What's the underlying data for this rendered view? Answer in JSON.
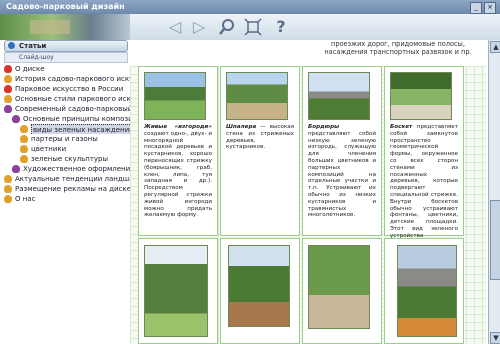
{
  "window": {
    "title": "Садово-парковый дизайн"
  },
  "toolbar": {
    "buttons": [
      "back-icon",
      "forward-icon",
      "search-icon",
      "fullscreen-icon",
      "help-icon"
    ]
  },
  "sidebar": {
    "tab": "Статьи",
    "subtab": "Слайд-шоу",
    "items": [
      {
        "label": "О диске"
      },
      {
        "label": "История садово-паркового искусства"
      },
      {
        "label": "Парковое искусство в России"
      },
      {
        "label": "Основные стили паркового искусства"
      },
      {
        "label": "Современный садово-парковый дизайн"
      },
      {
        "label": "Основные принципы композиции"
      },
      {
        "label": "виды зеленых насаждений"
      },
      {
        "label": "партеры и газоны"
      },
      {
        "label": "цветники"
      },
      {
        "label": "зеленые скульптуры"
      },
      {
        "label": "Художественное оформление территорий"
      },
      {
        "label": "Актуальные тенденции ландшафтного дизайна"
      },
      {
        "label": "Размещение рекламы на диске"
      },
      {
        "label": "О нас"
      }
    ]
  },
  "content": {
    "intro": "проезжих дорог, придомовые полосы, насаждения транспортных развязок и пр.",
    "captions": [
      {
        "term": "Живые «изгороди»",
        "text": "создают одно-, двух- и многорядной посадкой деревьев и кустарников, хорошо переносящих стрижку (боярышник, граб, клен, липа, туя западная и др.). Посредством регулярной стрижки живой изгороди можно придать желаемую форму."
      },
      {
        "term": "Шпалера",
        "text": "— высокая стена из стриженых деревьев, кустарников."
      },
      {
        "term": "Бордюры",
        "text": "представляют собой низкую зеленую изгородь, служащую для членения больших цветников и партерных композиций на отдельные участки и т.п. Устраивают их обычно из низких кустарников и травянистых многолетников."
      },
      {
        "term": "Боскет",
        "text": "представляет собой замкнутое пространство геометрической формы, окруженное со всех сторон стенами из посаженных деревьев, которые подвергают специальной стрижке. Внутри боскетов обычно устраивают фонтаны, цветники, детские площадки. Этот вид зеленого устройства составляет основу композиции растений при регулярных приемах парковой планировки."
      }
    ]
  },
  "colors": {
    "titlebar": "#6d88ab",
    "grid": "#9ccc8e",
    "selection": "#cfd8e4"
  }
}
